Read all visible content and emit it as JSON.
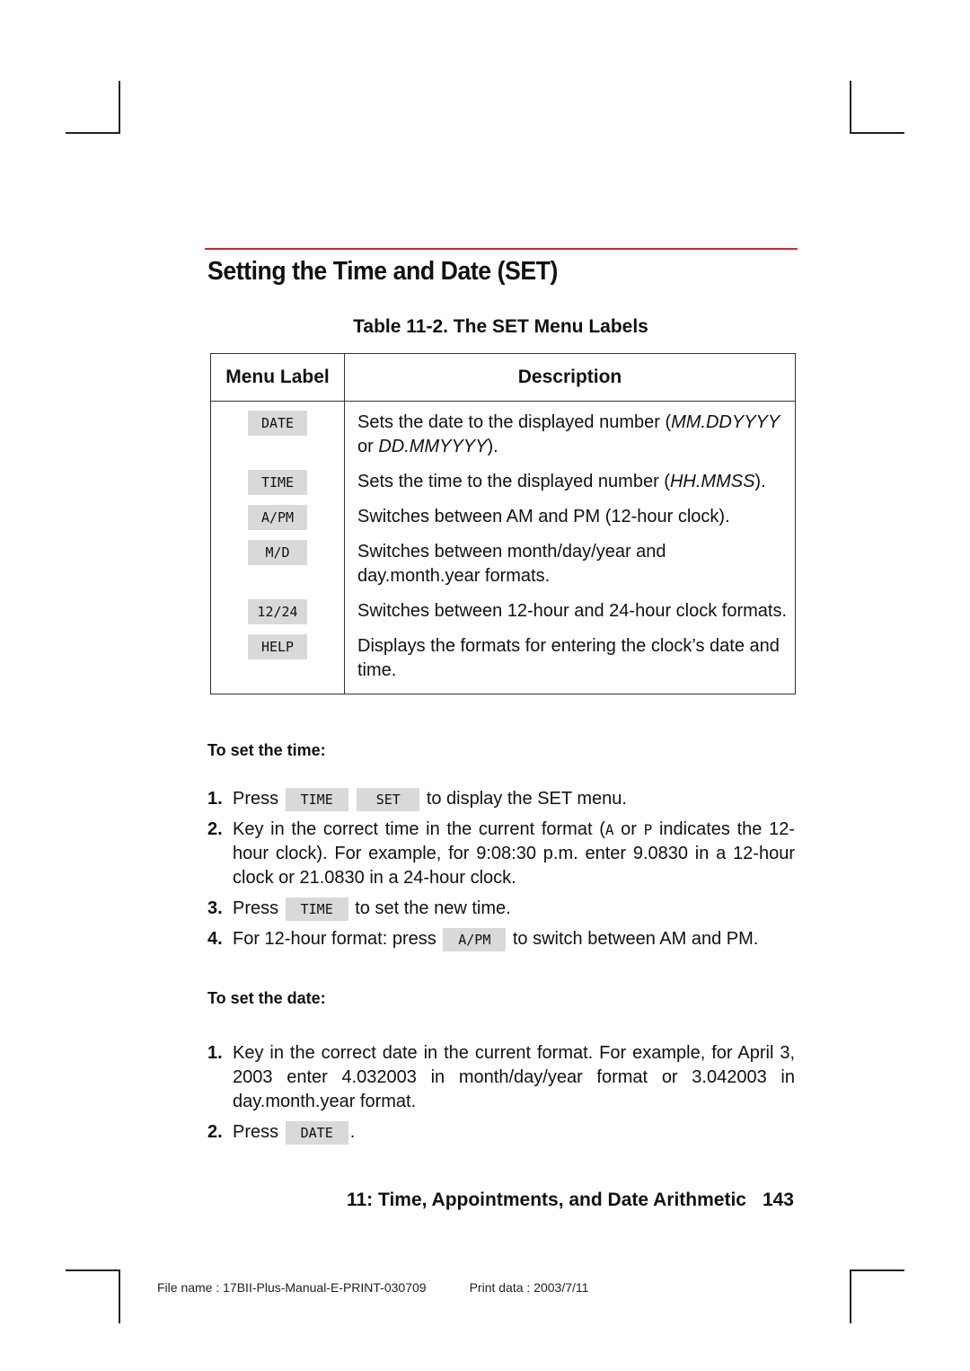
{
  "section": {
    "title": "Setting the Time and Date (SET)",
    "accent_color": "#e0202a"
  },
  "table": {
    "caption": "Table 11-2. The SET Menu Labels",
    "headers": [
      "Menu Label",
      "Description"
    ],
    "rows": [
      {
        "key": "DATE",
        "desc_pre": "Sets the date to the displayed number (",
        "desc_em1": "MM.DDYYYY",
        "desc_mid": " or ",
        "desc_em2": "DD.MMYYYY",
        "desc_post": ")."
      },
      {
        "key": "TIME",
        "desc_pre": "Sets the time to the displayed number (",
        "desc_em1": "HH.MMSS",
        "desc_post": ")."
      },
      {
        "key": "A/PM",
        "desc": "Switches between AM and PM (12-hour clock)."
      },
      {
        "key": "M/D",
        "desc": "Switches between month/day/year and day.month.year formats."
      },
      {
        "key": "12/24",
        "desc": "Switches between 12-hour and 24-hour clock formats."
      },
      {
        "key": "HELP",
        "desc": "Displays the formats for entering the clock’s date and time."
      }
    ]
  },
  "set_time": {
    "heading": "To set the time:",
    "steps": [
      {
        "num": "1.",
        "pre": "Press",
        "key1": "TIME",
        "key2": "SET",
        "post": "to display the SET menu."
      },
      {
        "num": "2.",
        "pre": "Key in the correct time in the current format (",
        "chip1": "A",
        "mid": " or ",
        "chip2": "P",
        "post": " indicates the 12-hour clock). For example, for 9:08:30 p.m. enter 9.0830 in a 12-hour clock or 21.0830 in a 24-hour clock."
      },
      {
        "num": "3.",
        "pre": "Press",
        "key1": "TIME",
        "post": "to set the new time."
      },
      {
        "num": "4.",
        "pre": "For 12-hour format: press",
        "key1": "A/PM",
        "post": "to switch between AM and PM."
      }
    ]
  },
  "set_date": {
    "heading": "To set the date:",
    "steps": [
      {
        "num": "1.",
        "text": "Key in the correct date in the current format. For example, for April 3, 2003 enter 4.032003 in month/day/year format or 3.042003 in day.month.year format."
      },
      {
        "num": "2.",
        "pre": "Press",
        "key1": "DATE",
        "post": "."
      }
    ]
  },
  "footer": {
    "chapter": "11: Time, Appointments, and Date Arithmetic",
    "page": "143",
    "file_name": "File name : 17BII-Plus-Manual-E-PRINT-030709",
    "print_date": "Print data : 2003/7/11"
  }
}
